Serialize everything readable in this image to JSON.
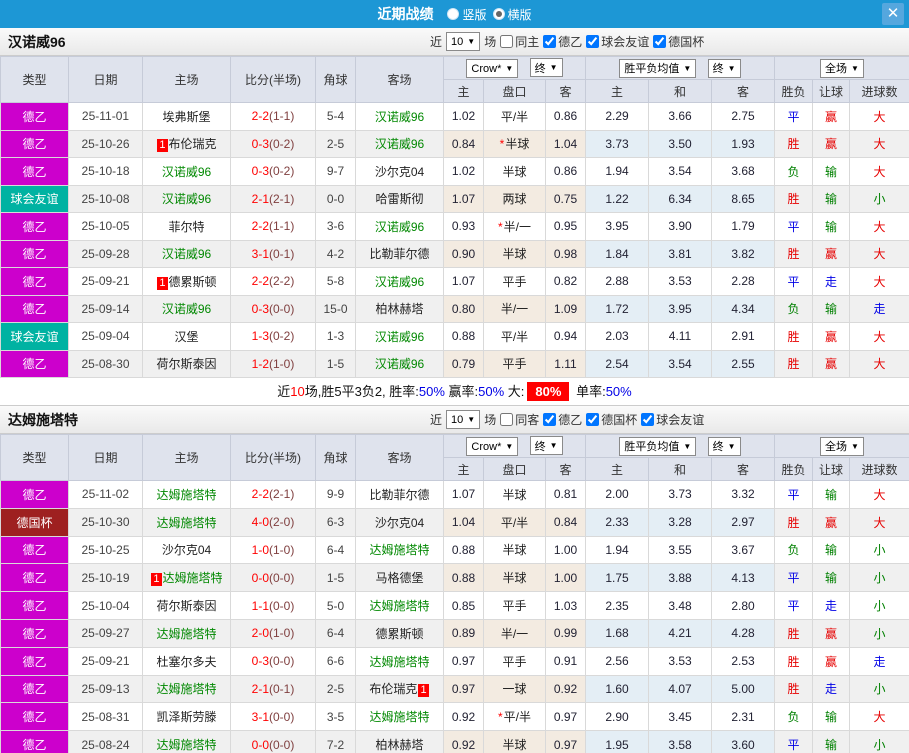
{
  "titlebar": {
    "title": "近期战绩",
    "radios": [
      {
        "label": "竖版",
        "checked": false
      },
      {
        "label": "横版",
        "checked": true
      }
    ],
    "close": "✕"
  },
  "cols": {
    "type": "类型",
    "date": "日期",
    "home": "主场",
    "score": "比分(半场)",
    "corner": "角球",
    "away": "客场",
    "book": "Crow*",
    "final": "终",
    "mean": "胜平负均值",
    "full": "全场",
    "o_home": "主",
    "o_hand": "盘口",
    "o_away": "客",
    "m_home": "主",
    "m_draw": "和",
    "m_away": "客",
    "wdl": "胜负",
    "handicap": "让球",
    "goals": "进球数"
  },
  "colors": {
    "accent_blue": "#1d97d5",
    "league_de2": "#cc00cc",
    "league_friendly": "#00b2a2",
    "league_cup": "#9e2020",
    "win_red": "#e60000",
    "draw_blue": "#0000e6",
    "lose_green": "#008000",
    "focal_green": "#008800",
    "score_red": "#ff0000"
  },
  "sections": [
    {
      "team": "汉诺威96",
      "filter": {
        "near": "近",
        "count": "10",
        "games": "场",
        "boxes": [
          {
            "label": "同主",
            "checked": false
          },
          {
            "label": "德乙",
            "checked": true
          },
          {
            "label": "球会友谊",
            "checked": true
          },
          {
            "label": "德国杯",
            "checked": true
          }
        ]
      },
      "rows": [
        {
          "lg": "德乙",
          "dt": "25-11-01",
          "hm": "埃弗斯堡",
          "hb": "",
          "sc": "2-2",
          "hf": "(1-1)",
          "cn": "5-4",
          "aw": "汉诺威96",
          "ab": "",
          "o1": "1.02",
          "st": false,
          "hd": "平/半",
          "o2": "0.86",
          "m1": "2.29",
          "m2": "3.66",
          "m3": "2.75",
          "r1": "平",
          "r2": "赢",
          "r3": "大"
        },
        {
          "lg": "德乙",
          "dt": "25-10-26",
          "hm": "布伦瑞克",
          "hb": "1",
          "sc": "0-3",
          "hf": "(0-2)",
          "cn": "2-5",
          "aw": "汉诺威96",
          "ab": "",
          "o1": "0.84",
          "st": true,
          "hd": "半球",
          "o2": "1.04",
          "m1": "3.73",
          "m2": "3.50",
          "m3": "1.93",
          "r1": "胜",
          "r2": "赢",
          "r3": "大"
        },
        {
          "lg": "德乙",
          "dt": "25-10-18",
          "hm": "汉诺威96",
          "hb": "",
          "sc": "0-3",
          "hf": "(0-2)",
          "cn": "9-7",
          "aw": "沙尔克04",
          "ab": "",
          "o1": "1.02",
          "st": false,
          "hd": "半球",
          "o2": "0.86",
          "m1": "1.94",
          "m2": "3.54",
          "m3": "3.68",
          "r1": "负",
          "r2": "输",
          "r3": "大"
        },
        {
          "lg": "球会友谊",
          "dt": "25-10-08",
          "hm": "汉诺威96",
          "hb": "",
          "sc": "2-1",
          "hf": "(2-1)",
          "cn": "0-0",
          "aw": "哈雷斯彻",
          "ab": "",
          "o1": "1.07",
          "st": false,
          "hd": "两球",
          "o2": "0.75",
          "m1": "1.22",
          "m2": "6.34",
          "m3": "8.65",
          "r1": "胜",
          "r2": "输",
          "r3": "小"
        },
        {
          "lg": "德乙",
          "dt": "25-10-05",
          "hm": "菲尔特",
          "hb": "",
          "sc": "2-2",
          "hf": "(1-1)",
          "cn": "3-6",
          "aw": "汉诺威96",
          "ab": "",
          "o1": "0.93",
          "st": true,
          "hd": "半/一",
          "o2": "0.95",
          "m1": "3.95",
          "m2": "3.90",
          "m3": "1.79",
          "r1": "平",
          "r2": "输",
          "r3": "大"
        },
        {
          "lg": "德乙",
          "dt": "25-09-28",
          "hm": "汉诺威96",
          "hb": "",
          "sc": "3-1",
          "hf": "(0-1)",
          "cn": "4-2",
          "aw": "比勒菲尔德",
          "ab": "",
          "o1": "0.90",
          "st": false,
          "hd": "半球",
          "o2": "0.98",
          "m1": "1.84",
          "m2": "3.81",
          "m3": "3.82",
          "r1": "胜",
          "r2": "赢",
          "r3": "大"
        },
        {
          "lg": "德乙",
          "dt": "25-09-21",
          "hm": "德累斯顿",
          "hb": "1",
          "sc": "2-2",
          "hf": "(2-2)",
          "cn": "5-8",
          "aw": "汉诺威96",
          "ab": "",
          "o1": "1.07",
          "st": false,
          "hd": "平手",
          "o2": "0.82",
          "m1": "2.88",
          "m2": "3.53",
          "m3": "2.28",
          "r1": "平",
          "r2": "走",
          "r3": "大"
        },
        {
          "lg": "德乙",
          "dt": "25-09-14",
          "hm": "汉诺威96",
          "hb": "",
          "sc": "0-3",
          "hf": "(0-0)",
          "cn": "15-0",
          "aw": "柏林赫塔",
          "ab": "",
          "o1": "0.80",
          "st": false,
          "hd": "半/一",
          "o2": "1.09",
          "m1": "1.72",
          "m2": "3.95",
          "m3": "4.34",
          "r1": "负",
          "r2": "输",
          "r3": "走"
        },
        {
          "lg": "球会友谊",
          "dt": "25-09-04",
          "hm": "汉堡",
          "hb": "",
          "sc": "1-3",
          "hf": "(0-2)",
          "cn": "1-3",
          "aw": "汉诺威96",
          "ab": "",
          "o1": "0.88",
          "st": false,
          "hd": "平/半",
          "o2": "0.94",
          "m1": "2.03",
          "m2": "4.11",
          "m3": "2.91",
          "r1": "胜",
          "r2": "赢",
          "r3": "大"
        },
        {
          "lg": "德乙",
          "dt": "25-08-30",
          "hm": "荷尔斯泰因",
          "hb": "",
          "sc": "1-2",
          "hf": "(1-0)",
          "cn": "1-5",
          "aw": "汉诺威96",
          "ab": "",
          "o1": "0.79",
          "st": false,
          "hd": "平手",
          "o2": "1.11",
          "m1": "2.54",
          "m2": "3.54",
          "m3": "2.55",
          "r1": "胜",
          "r2": "赢",
          "r3": "大"
        }
      ],
      "summary": [
        {
          "t": "近",
          "c": "k"
        },
        {
          "t": "10",
          "c": "r"
        },
        {
          "t": "场,胜5平3负2, 胜率:",
          "c": "k"
        },
        {
          "t": "50%",
          "c": "b"
        },
        {
          "t": " 赢率:",
          "c": "k"
        },
        {
          "t": "50%",
          "c": "b"
        },
        {
          "t": " 大:",
          "c": "k"
        },
        {
          "t": "80%",
          "c": "hl"
        },
        {
          "t": " 单率:",
          "c": "k"
        },
        {
          "t": "50%",
          "c": "b"
        }
      ]
    },
    {
      "team": "达姆施塔特",
      "filter": {
        "near": "近",
        "count": "10",
        "games": "场",
        "boxes": [
          {
            "label": "同客",
            "checked": false
          },
          {
            "label": "德乙",
            "checked": true
          },
          {
            "label": "德国杯",
            "checked": true
          },
          {
            "label": "球会友谊",
            "checked": true
          }
        ]
      },
      "rows": [
        {
          "lg": "德乙",
          "dt": "25-11-02",
          "hm": "达姆施塔特",
          "hb": "",
          "sc": "2-2",
          "hf": "(2-1)",
          "cn": "9-9",
          "aw": "比勒菲尔德",
          "ab": "",
          "o1": "1.07",
          "st": false,
          "hd": "半球",
          "o2": "0.81",
          "m1": "2.00",
          "m2": "3.73",
          "m3": "3.32",
          "r1": "平",
          "r2": "输",
          "r3": "大"
        },
        {
          "lg": "德国杯",
          "dt": "25-10-30",
          "hm": "达姆施塔特",
          "hb": "",
          "sc": "4-0",
          "hf": "(2-0)",
          "cn": "6-3",
          "aw": "沙尔克04",
          "ab": "",
          "o1": "1.04",
          "st": false,
          "hd": "平/半",
          "o2": "0.84",
          "m1": "2.33",
          "m2": "3.28",
          "m3": "2.97",
          "r1": "胜",
          "r2": "赢",
          "r3": "大"
        },
        {
          "lg": "德乙",
          "dt": "25-10-25",
          "hm": "沙尔克04",
          "hb": "",
          "sc": "1-0",
          "hf": "(1-0)",
          "cn": "6-4",
          "aw": "达姆施塔特",
          "ab": "",
          "o1": "0.88",
          "st": false,
          "hd": "半球",
          "o2": "1.00",
          "m1": "1.94",
          "m2": "3.55",
          "m3": "3.67",
          "r1": "负",
          "r2": "输",
          "r3": "小"
        },
        {
          "lg": "德乙",
          "dt": "25-10-19",
          "hm": "达姆施塔特",
          "hb": "1",
          "sc": "0-0",
          "hf": "(0-0)",
          "cn": "1-5",
          "aw": "马格德堡",
          "ab": "",
          "o1": "0.88",
          "st": false,
          "hd": "半球",
          "o2": "1.00",
          "m1": "1.75",
          "m2": "3.88",
          "m3": "4.13",
          "r1": "平",
          "r2": "输",
          "r3": "小"
        },
        {
          "lg": "德乙",
          "dt": "25-10-04",
          "hm": "荷尔斯泰因",
          "hb": "",
          "sc": "1-1",
          "hf": "(0-0)",
          "cn": "5-0",
          "aw": "达姆施塔特",
          "ab": "",
          "o1": "0.85",
          "st": false,
          "hd": "平手",
          "o2": "1.03",
          "m1": "2.35",
          "m2": "3.48",
          "m3": "2.80",
          "r1": "平",
          "r2": "走",
          "r3": "小"
        },
        {
          "lg": "德乙",
          "dt": "25-09-27",
          "hm": "达姆施塔特",
          "hb": "",
          "sc": "2-0",
          "hf": "(1-0)",
          "cn": "6-4",
          "aw": "德累斯顿",
          "ab": "",
          "o1": "0.89",
          "st": false,
          "hd": "半/一",
          "o2": "0.99",
          "m1": "1.68",
          "m2": "4.21",
          "m3": "4.28",
          "r1": "胜",
          "r2": "赢",
          "r3": "小"
        },
        {
          "lg": "德乙",
          "dt": "25-09-21",
          "hm": "杜塞尔多夫",
          "hb": "",
          "sc": "0-3",
          "hf": "(0-0)",
          "cn": "6-6",
          "aw": "达姆施塔特",
          "ab": "",
          "o1": "0.97",
          "st": false,
          "hd": "平手",
          "o2": "0.91",
          "m1": "2.56",
          "m2": "3.53",
          "m3": "2.53",
          "r1": "胜",
          "r2": "赢",
          "r3": "走"
        },
        {
          "lg": "德乙",
          "dt": "25-09-13",
          "hm": "达姆施塔特",
          "hb": "",
          "sc": "2-1",
          "hf": "(0-1)",
          "cn": "2-5",
          "aw": "布伦瑞克",
          "ab": "1",
          "o1": "0.97",
          "st": false,
          "hd": "一球",
          "o2": "0.92",
          "m1": "1.60",
          "m2": "4.07",
          "m3": "5.00",
          "r1": "胜",
          "r2": "走",
          "r3": "小"
        },
        {
          "lg": "德乙",
          "dt": "25-08-31",
          "hm": "凯泽斯劳滕",
          "hb": "",
          "sc": "3-1",
          "hf": "(0-0)",
          "cn": "3-5",
          "aw": "达姆施塔特",
          "ab": "",
          "o1": "0.92",
          "st": true,
          "hd": "平/半",
          "o2": "0.97",
          "m1": "2.90",
          "m2": "3.45",
          "m3": "2.31",
          "r1": "负",
          "r2": "输",
          "r3": "大"
        },
        {
          "lg": "德乙",
          "dt": "25-08-24",
          "hm": "达姆施塔特",
          "hb": "",
          "sc": "0-0",
          "hf": "(0-0)",
          "cn": "7-2",
          "aw": "柏林赫塔",
          "ab": "",
          "o1": "0.92",
          "st": false,
          "hd": "半球",
          "o2": "0.97",
          "m1": "1.95",
          "m2": "3.58",
          "m3": "3.60",
          "r1": "平",
          "r2": "输",
          "r3": "小"
        }
      ],
      "summary": []
    }
  ]
}
